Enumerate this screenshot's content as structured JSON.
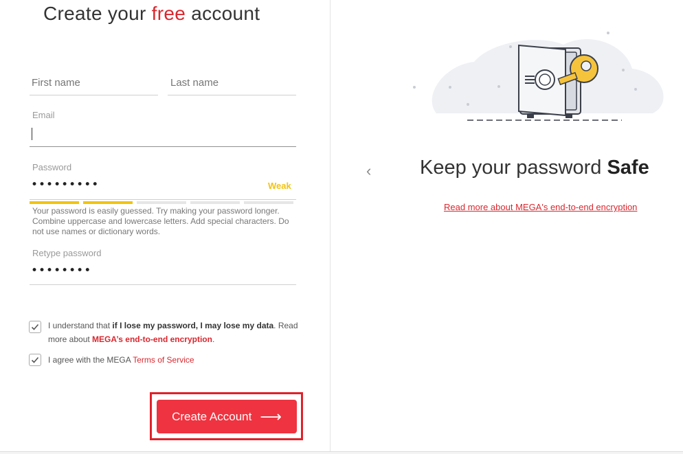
{
  "form": {
    "title_pre": "Create your ",
    "title_accent": "free",
    "title_post": " account",
    "first_name_placeholder": "First name",
    "last_name_placeholder": "Last name",
    "email_label": "Email",
    "email_value": "",
    "password_label": "Password",
    "password_masked": "•••••••••",
    "strength_label": "Weak",
    "strength_level_segments": 2,
    "strength_total_segments": 5,
    "password_hint": "Your password is easily guessed. Try making your password longer. Combine uppercase and lowercase letters. Add special characters. Do not use names or dictionary words.",
    "retype_label": "Retype password",
    "retype_masked": "••••••••",
    "check1_pre": "I understand that ",
    "check1_bold": "if I lose my password, I may lose my data",
    "check1_mid": ". Read more about ",
    "check1_link": "MEGA’s end-to-end encryption",
    "check1_post": ".",
    "check1_checked": true,
    "check2_pre": "I agree with the MEGA ",
    "check2_link": "Terms of Service",
    "check2_checked": true,
    "create_button": "Create Account",
    "create_arrow": "⟶"
  },
  "info": {
    "prev_arrow": "‹",
    "heading_pre": "Keep your password ",
    "heading_bold": "Safe",
    "read_more": "Read more about MEGA's end-to-end encryption"
  },
  "colors": {
    "accent": "#d9272e",
    "button": "#ef3340",
    "strength_weak": "#f2c30f"
  },
  "icons": {
    "checkbox_check": "check-icon",
    "illustration": "safe-with-key-illustration"
  }
}
